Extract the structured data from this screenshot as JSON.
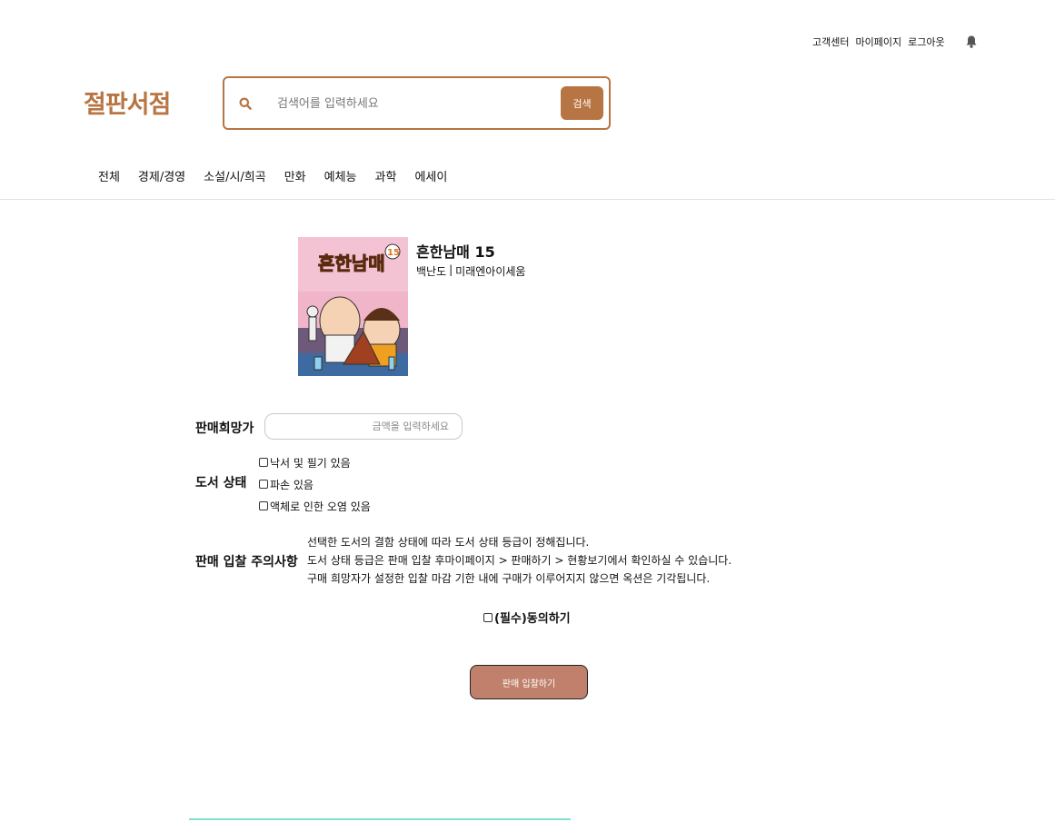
{
  "header": {
    "links": [
      "고객센터",
      "마이페이지",
      "로그아웃"
    ],
    "bell_icon": "bell-icon",
    "logo": "절판서점",
    "search": {
      "placeholder": "검색어를 입력하세요",
      "value": "",
      "button_label": "검색",
      "icon": "search-icon"
    }
  },
  "nav": {
    "categories": [
      "전체",
      "경제/경영",
      "소설/시/희곡",
      "만화",
      "예체능",
      "과학",
      "에세이"
    ]
  },
  "book": {
    "title": "흔한남매 15",
    "author": "백난도",
    "separator": "|",
    "publisher": "미래엔아이세움",
    "cover": {
      "title_text": "흔한남매",
      "volume": "15"
    }
  },
  "form": {
    "price_label": "판매희망가",
    "price_placeholder": "금액을 입력하세요",
    "price_value": "",
    "condition_label": "도서 상태",
    "conditions": [
      {
        "label": "낙서 및 필기 있음",
        "checked": false
      },
      {
        "label": "파손 있음",
        "checked": false
      },
      {
        "label": "액체로 인한 오염 있음",
        "checked": false
      }
    ],
    "notice_label": "판매 입찰 주의사항",
    "notice_lines": [
      "선택한 도서의 결함 상태에 따라 도서 상태 등급이 정해집니다.",
      "도서 상태 등급은 판매 입찰 후마이페이지 > 판매하기 > 현황보기에서 확인하실 수 있습니다.",
      "구매 희망자가 설정한 입찰 마감 기한 내에 구매가 이루어지지 않으면 옥션은 기각됩니다."
    ],
    "agree_label": "(필수)동의하기",
    "agree_checked": false,
    "submit_label": "판매 입찰하기"
  },
  "colors": {
    "brand": "#b87544",
    "submit": "#c0806c",
    "cover_bg": "#f0b5c8",
    "accent_line": "#7fe0cf"
  }
}
